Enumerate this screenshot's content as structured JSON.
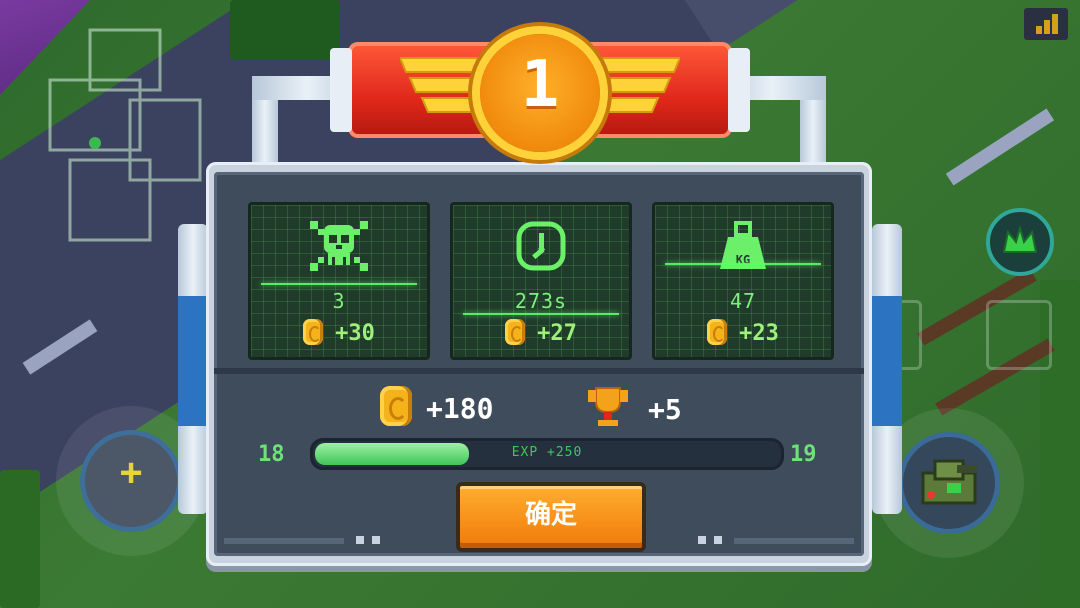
{
  "rank": {
    "number": "1"
  },
  "stats": [
    {
      "icon": "skull-icon",
      "value": "3",
      "reward": "+30"
    },
    {
      "icon": "clock-icon",
      "value": "273s",
      "reward": "+27"
    },
    {
      "icon": "weight-icon",
      "icon_label": "KG",
      "value": "47",
      "reward": "+23"
    }
  ],
  "totals": {
    "coins": "+180",
    "trophies": "+5"
  },
  "level": {
    "current": "18",
    "next": "19",
    "exp_label": "EXP +250",
    "progress_fraction": 0.33
  },
  "confirm_label": "确定",
  "colors": {
    "accent_green": "#7cf07a",
    "button_orange": "#f59a1c",
    "banner_red": "#e0281a"
  }
}
